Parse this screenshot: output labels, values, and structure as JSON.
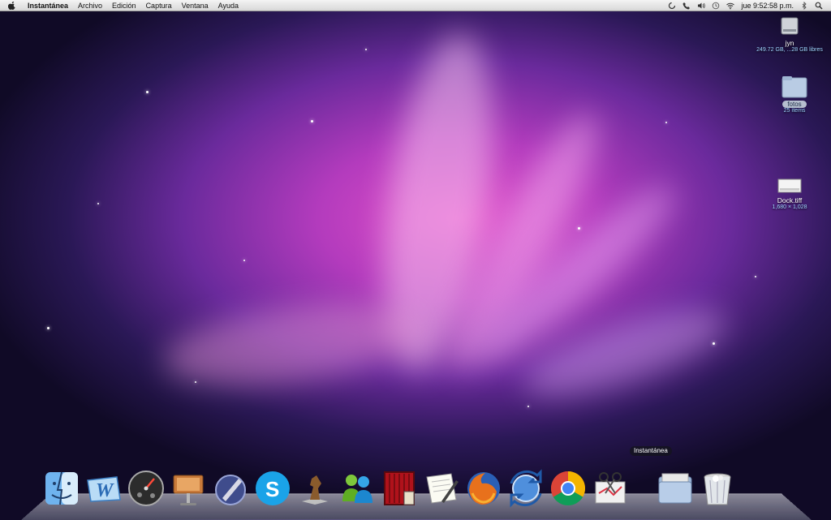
{
  "menubar": {
    "app_name": "Instantánea",
    "items": [
      "Archivo",
      "Edición",
      "Captura",
      "Ventana",
      "Ayuda"
    ],
    "clock": "jue 9:52:58 p.m."
  },
  "desktop": {
    "disk": {
      "name": "jyn",
      "info": "249.72 GB, ...28 GB libres"
    },
    "folder": {
      "name": "fotos",
      "info": "25 ítems"
    },
    "file": {
      "name": "Dock.tiff",
      "info": "1,680 × 1,028"
    }
  },
  "dock": {
    "tooltip": "Instantánea",
    "apps": [
      "finder",
      "word",
      "dashboard",
      "keynote",
      "pen-tool",
      "skype",
      "chess",
      "messenger",
      "front-row",
      "textedit",
      "firefox",
      "sync",
      "chrome",
      "instantanea",
      "folder",
      "trash"
    ]
  },
  "colors": {
    "wallpaper_core": "#e24fc9",
    "wallpaper_edge": "#100a26"
  }
}
